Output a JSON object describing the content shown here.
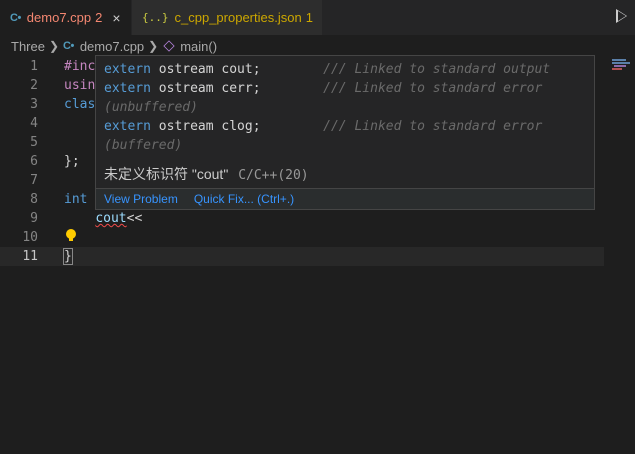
{
  "tabs": [
    {
      "icon": "cpp-file-icon",
      "icon_text": "C•",
      "name": "demo7.cpp",
      "count": "2",
      "close": "×"
    },
    {
      "icon": "json-file-icon",
      "icon_text": "{..}",
      "name": "c_cpp_properties.json",
      "count": "1"
    }
  ],
  "breadcrumb": {
    "root": "Three",
    "file_icon_text": "C•",
    "file": "demo7.cpp",
    "symbol": "main()"
  },
  "editor": {
    "lines": [
      {
        "n": "1",
        "tokens": [
          {
            "t": "#inc",
            "c": "kw2"
          }
        ]
      },
      {
        "n": "2",
        "tokens": [
          {
            "t": "usin",
            "c": "kw2"
          }
        ]
      },
      {
        "n": "3",
        "tokens": [
          {
            "t": "clas",
            "c": "kw"
          }
        ]
      },
      {
        "n": "4",
        "tokens": []
      },
      {
        "n": "5",
        "tokens": []
      },
      {
        "n": "6",
        "tokens": [
          {
            "t": "};",
            "c": "plain"
          }
        ]
      },
      {
        "n": "7",
        "tokens": []
      },
      {
        "n": "8",
        "tokens": [
          {
            "t": "int",
            "c": "kw"
          }
        ]
      },
      {
        "n": "9",
        "tokens": [
          {
            "t": "    ",
            "c": "plain"
          },
          {
            "t": "cout",
            "c": "var err-word"
          },
          {
            "t": "<<",
            "c": "plain"
          }
        ]
      },
      {
        "n": "10",
        "tokens": []
      },
      {
        "n": "11",
        "tokens": [
          {
            "t": "}",
            "c": "plain bracket-box"
          }
        ]
      }
    ]
  },
  "hover": {
    "code_lines": [
      [
        {
          "t": "extern",
          "c": "hv-kw"
        },
        {
          "t": " ostream cout;        ",
          "c": "hv-plain"
        },
        {
          "t": "/// Linked to standard output",
          "c": "hv-cmt"
        }
      ],
      [
        {
          "t": "extern",
          "c": "hv-kw"
        },
        {
          "t": " ostream cerr;        ",
          "c": "hv-plain"
        },
        {
          "t": "/// Linked to standard error",
          "c": "hv-cmt"
        }
      ],
      [
        {
          "t": "(unbuffered)",
          "c": "hv-cmt"
        }
      ],
      [
        {
          "t": "extern",
          "c": "hv-kw"
        },
        {
          "t": " ostream clog;        ",
          "c": "hv-plain"
        },
        {
          "t": "/// Linked to standard error",
          "c": "hv-cmt"
        }
      ],
      [
        {
          "t": "(buffered)",
          "c": "hv-cmt"
        }
      ]
    ],
    "message": "未定义标识符 \"cout\"",
    "source": "C/C++(20)",
    "view_problem": "View Problem",
    "quick_fix": "Quick Fix... (Ctrl+.)"
  }
}
